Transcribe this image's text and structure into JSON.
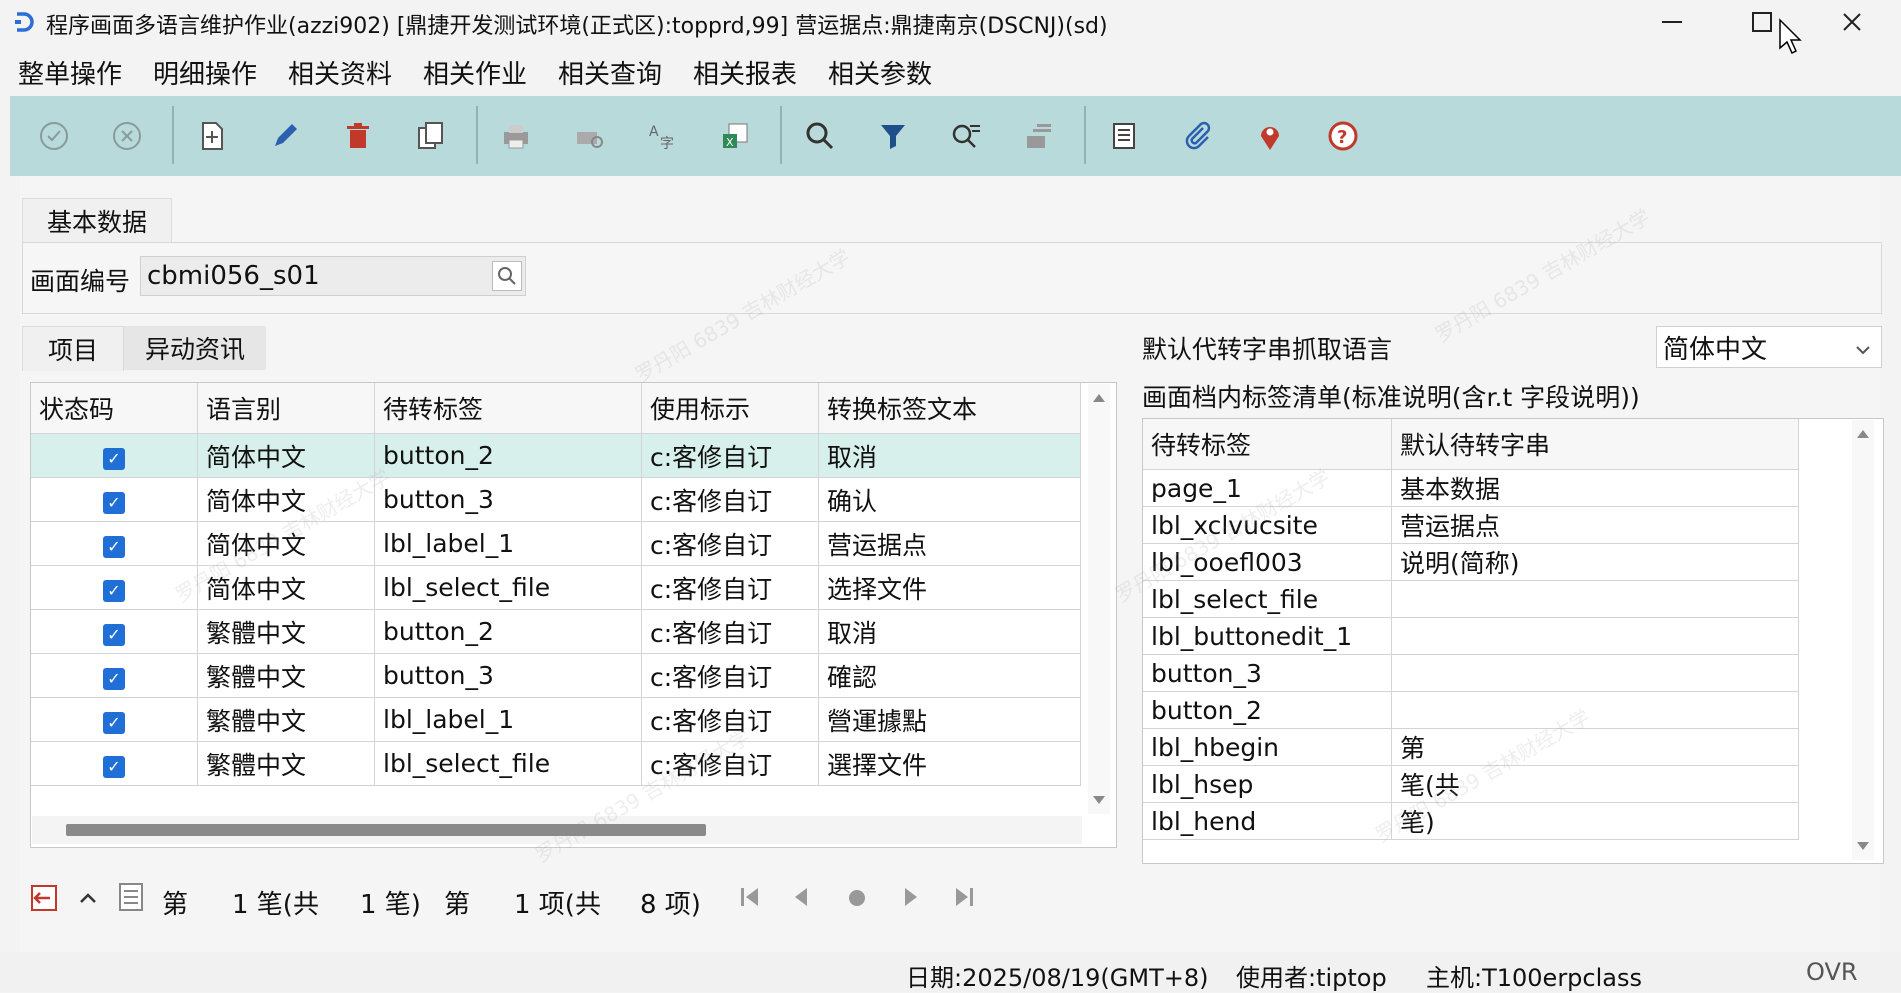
{
  "window": {
    "title": "程序画面多语言维护作业(azzi902)    [鼎捷开发测试环境(正式区):topprd,99]    营运据点:鼎捷南京(DSCNJ)(sd)",
    "minimize": "—",
    "maximize": "☐",
    "close": "✕"
  },
  "menu": [
    "整单操作",
    "明细操作",
    "相关资料",
    "相关作业",
    "相关查询",
    "相关报表",
    "相关参数"
  ],
  "toolbar": {
    "icons": [
      "confirm-icon",
      "cancel-icon",
      "add-icon",
      "edit-icon",
      "delete-icon",
      "copy-icon",
      "print-icon",
      "print-preview-icon",
      "translate-icon",
      "excel-export-icon",
      "search-icon",
      "filter-icon",
      "query-icon",
      "stack-icon",
      "list-icon",
      "attachment-icon",
      "location-pin-icon",
      "help-icon"
    ],
    "colors": {
      "background": "#b9dada",
      "delete": "#c0392b",
      "pin": "#c0392b",
      "help": "#c0392b",
      "edit": "#2b5fb0"
    }
  },
  "basic": {
    "tab_label": "基本数据",
    "screen_no_label": "画面编号",
    "screen_no_value": "cbmi056_s01"
  },
  "detail_tabs": [
    "项目",
    "异动资讯"
  ],
  "items_table": {
    "headers": [
      "状态码",
      "语言别",
      "待转标签",
      "使用标示",
      "转换标签文本"
    ],
    "rows": [
      {
        "checked": "✓",
        "lang": "简体中文",
        "tag": "button_2",
        "use": "c:客修自订",
        "text": "取消"
      },
      {
        "checked": "✓",
        "lang": "简体中文",
        "tag": "button_3",
        "use": "c:客修自订",
        "text": "确认"
      },
      {
        "checked": "✓",
        "lang": "简体中文",
        "tag": "lbl_label_1",
        "use": "c:客修自订",
        "text": "营运据点"
      },
      {
        "checked": "✓",
        "lang": "简体中文",
        "tag": "lbl_select_file",
        "use": "c:客修自订",
        "text": "选择文件"
      },
      {
        "checked": "✓",
        "lang": "繁體中文",
        "tag": "button_2",
        "use": "c:客修自订",
        "text": "取消"
      },
      {
        "checked": "✓",
        "lang": "繁體中文",
        "tag": "button_3",
        "use": "c:客修自订",
        "text": "確認"
      },
      {
        "checked": "✓",
        "lang": "繁體中文",
        "tag": "lbl_label_1",
        "use": "c:客修自订",
        "text": "營運據點"
      },
      {
        "checked": "✓",
        "lang": "繁體中文",
        "tag": "lbl_select_file",
        "use": "c:客修自订",
        "text": "選擇文件"
      }
    ]
  },
  "right_panel": {
    "lang_label": "默认代转字串抓取语言",
    "lang_value": "简体中文",
    "list_title": "画面档内标签清单(标准说明(含r.t 字段说明))",
    "headers": [
      "待转标签",
      "默认待转字串"
    ],
    "rows": [
      {
        "tag": "page_1",
        "text": "基本数据"
      },
      {
        "tag": "lbl_xclvucsite",
        "text": "营运据点"
      },
      {
        "tag": "lbl_ooefl003",
        "text": "说明(简称)"
      },
      {
        "tag": "lbl_select_file",
        "text": ""
      },
      {
        "tag": "lbl_buttonedit_1",
        "text": ""
      },
      {
        "tag": "button_3",
        "text": ""
      },
      {
        "tag": "button_2",
        "text": ""
      },
      {
        "tag": "lbl_hbegin",
        "text": "第"
      },
      {
        "tag": "lbl_hsep",
        "text": "笔(共"
      },
      {
        "tag": "lbl_hend",
        "text": "笔)"
      }
    ]
  },
  "pager": {
    "t1": "第",
    "t2": "1 笔(共",
    "t3": "1 笔)",
    "t4": "第",
    "t5": "1 项(共",
    "t6": "8 项)"
  },
  "status": {
    "date": "日期:2025/08/19(GMT+8)",
    "user": "使用者:tiptop",
    "host": "主机:T100erpclass",
    "mode": "OVR"
  },
  "watermark": "罗丹阳 6839  吉林财经大学"
}
